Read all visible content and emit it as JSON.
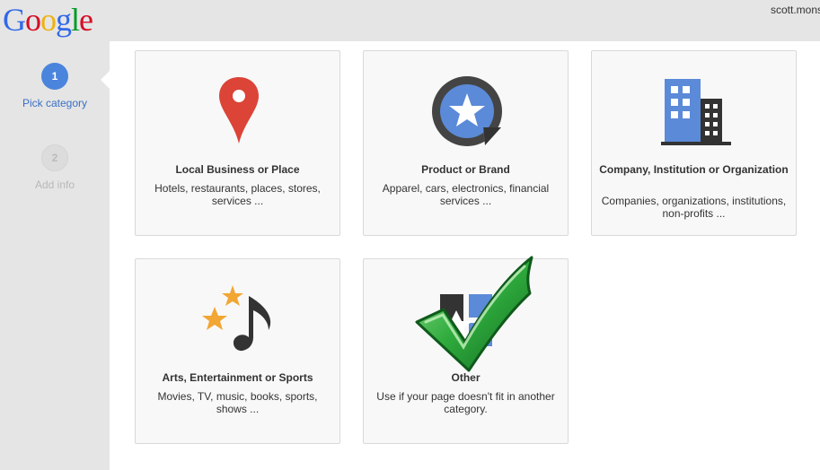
{
  "header": {
    "logo_letters": [
      "G",
      "o",
      "o",
      "g",
      "l",
      "e"
    ],
    "logo_colors": [
      "#3369e8",
      "#d50f25",
      "#eeb211",
      "#3369e8",
      "#009925",
      "#d50f25"
    ],
    "user_label": "scott.mons"
  },
  "sidebar": {
    "steps": [
      {
        "number": "1",
        "label": "Pick category",
        "state": "active"
      },
      {
        "number": "2",
        "label": "Add info",
        "state": "inactive"
      }
    ]
  },
  "categories": [
    {
      "title": "Local Business or Place",
      "description": "Hotels, restaurants, places, stores, services ...",
      "icon": "map-pin-icon",
      "color": "#db4437"
    },
    {
      "title": "Product or Brand",
      "description": "Apparel, cars, electronics, financial services ...",
      "icon": "product-sticker-icon",
      "color": "#4a84dd"
    },
    {
      "title": "Company, Institution or Organization",
      "description": "Companies, organizations, institutions, non-profits ...",
      "icon": "buildings-icon",
      "color": "#4a84dd"
    },
    {
      "title": "Arts, Entertainment or Sports",
      "description": "Movies, TV, music, books, sports, shows ...",
      "icon": "music-stars-icon",
      "color": "#f2a633"
    },
    {
      "title": "Other",
      "description": "Use if your page doesn't fit in another category.",
      "icon": "other-shapes-icon",
      "color": "#4a84dd"
    }
  ],
  "overlay": {
    "icon": "green-checkmark-icon",
    "color": "#2eaa3c"
  }
}
